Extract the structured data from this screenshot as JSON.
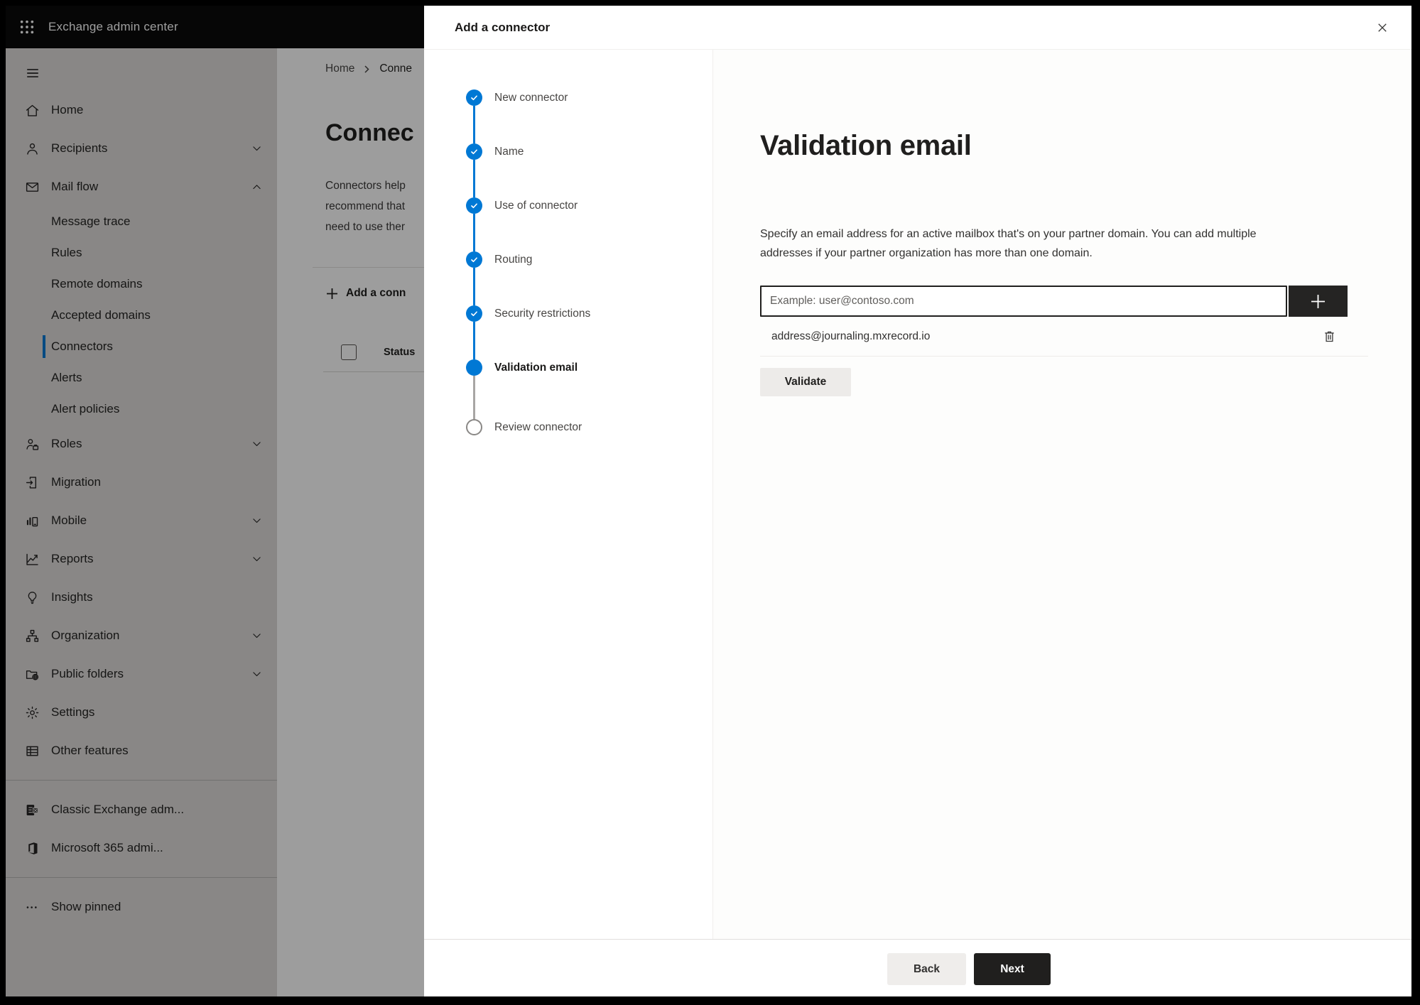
{
  "topbar": {
    "app_title": "Exchange admin center"
  },
  "sidebar": {
    "items": [
      {
        "type": "item",
        "icon": "home",
        "label": "Home"
      },
      {
        "type": "item",
        "icon": "person",
        "label": "Recipients",
        "chevron": "down"
      },
      {
        "type": "item",
        "icon": "mail",
        "label": "Mail flow",
        "chevron": "up"
      },
      {
        "type": "subitem",
        "label": "Message trace"
      },
      {
        "type": "subitem",
        "label": "Rules"
      },
      {
        "type": "subitem",
        "label": "Remote domains"
      },
      {
        "type": "subitem",
        "label": "Accepted domains"
      },
      {
        "type": "subitem",
        "label": "Connectors",
        "selected": true
      },
      {
        "type": "subitem",
        "label": "Alerts"
      },
      {
        "type": "subitem",
        "label": "Alert policies"
      },
      {
        "type": "item",
        "icon": "roles",
        "label": "Roles",
        "chevron": "down"
      },
      {
        "type": "item",
        "icon": "migration",
        "label": "Migration"
      },
      {
        "type": "item",
        "icon": "mobile",
        "label": "Mobile",
        "chevron": "down"
      },
      {
        "type": "item",
        "icon": "reports",
        "label": "Reports",
        "chevron": "down"
      },
      {
        "type": "item",
        "icon": "insights",
        "label": "Insights"
      },
      {
        "type": "item",
        "icon": "organization",
        "label": "Organization",
        "chevron": "down"
      },
      {
        "type": "item",
        "icon": "public-folders",
        "label": "Public folders",
        "chevron": "down"
      },
      {
        "type": "item",
        "icon": "settings",
        "label": "Settings"
      },
      {
        "type": "item",
        "icon": "grid",
        "label": "Other features"
      },
      {
        "type": "divider"
      },
      {
        "type": "item",
        "icon": "classic-exchange",
        "label": "Classic Exchange adm..."
      },
      {
        "type": "item",
        "icon": "microsoft-365",
        "label": "Microsoft 365 admi..."
      },
      {
        "type": "divider"
      },
      {
        "type": "item",
        "icon": "more-dots",
        "label": "Show pinned"
      }
    ]
  },
  "page": {
    "breadcrumb": {
      "home": "Home",
      "current": "Conne"
    },
    "title": "Connec",
    "description_lines": [
      "Connectors help",
      "recommend that",
      "need to use ther"
    ],
    "add_button_label": "Add a conn",
    "table": {
      "status_header": "Status"
    }
  },
  "modal": {
    "title": "Add a connector",
    "steps": [
      {
        "label": "New connector",
        "state": "completed"
      },
      {
        "label": "Name",
        "state": "completed"
      },
      {
        "label": "Use of connector",
        "state": "completed"
      },
      {
        "label": "Routing",
        "state": "completed"
      },
      {
        "label": "Security restrictions",
        "state": "completed"
      },
      {
        "label": "Validation email",
        "state": "active"
      },
      {
        "label": "Review connector",
        "state": "upcoming"
      }
    ],
    "content": {
      "heading": "Validation email",
      "description": "Specify an email address for an active mailbox that's on your partner domain. You can add multiple addresses if your partner organization has more than one domain.",
      "email_input_placeholder": "Example: user@contoso.com",
      "addresses": [
        "address@journaling.mxrecord.io"
      ],
      "validate_label": "Validate"
    },
    "footer": {
      "back_label": "Back",
      "next_label": "Next"
    }
  },
  "colors": {
    "accent": "#0078d4",
    "topbar_bg": "#0a0a0a",
    "sidebar_bg": "#dedcda",
    "next_button_bg": "#201f1e",
    "plus_button_bg": "#252423",
    "validate_button_bg": "#edebe9",
    "back_button_bg": "#efedeb",
    "overlay": "rgba(0,0,0,0.385)"
  }
}
